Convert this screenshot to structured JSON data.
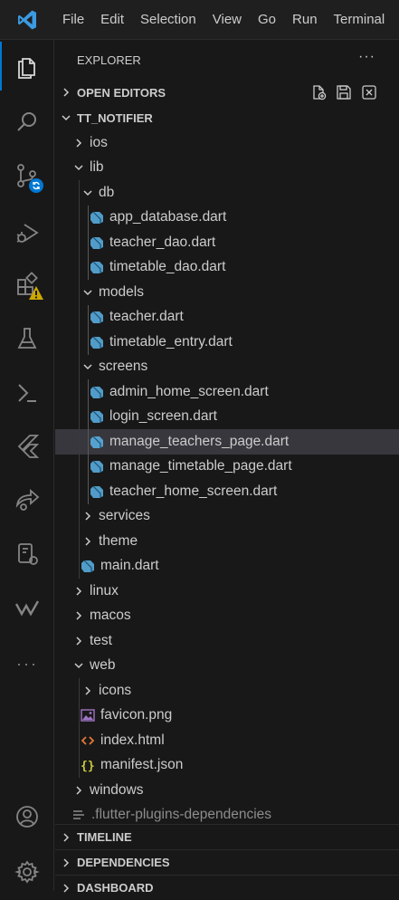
{
  "menu": [
    "File",
    "Edit",
    "Selection",
    "View",
    "Go",
    "Run",
    "Terminal"
  ],
  "activity_icons": [
    "explorer-icon",
    "search-icon",
    "source-control-icon",
    "run-debug-icon",
    "extensions-icon",
    "testing-icon",
    "remote-icon",
    "flutter-icon",
    "liveshare-icon",
    "devices-icon",
    "wakatime-icon",
    "more-icon"
  ],
  "explorer": {
    "title": "EXPLORER",
    "more": "···",
    "open_editors": "OPEN EDITORS",
    "project": "TT_NOTIFIER",
    "tree": [
      {
        "name": "ios",
        "type": "folder",
        "depth": 0,
        "open": false
      },
      {
        "name": "lib",
        "type": "folder",
        "depth": 0,
        "open": true
      },
      {
        "name": "db",
        "type": "folder",
        "depth": 1,
        "open": true
      },
      {
        "name": "app_database.dart",
        "type": "dart",
        "depth": 2
      },
      {
        "name": "teacher_dao.dart",
        "type": "dart",
        "depth": 2
      },
      {
        "name": "timetable_dao.dart",
        "type": "dart",
        "depth": 2
      },
      {
        "name": "models",
        "type": "folder",
        "depth": 1,
        "open": true
      },
      {
        "name": "teacher.dart",
        "type": "dart",
        "depth": 2
      },
      {
        "name": "timetable_entry.dart",
        "type": "dart",
        "depth": 2
      },
      {
        "name": "screens",
        "type": "folder",
        "depth": 1,
        "open": true
      },
      {
        "name": "admin_home_screen.dart",
        "type": "dart",
        "depth": 2
      },
      {
        "name": "login_screen.dart",
        "type": "dart",
        "depth": 2
      },
      {
        "name": "manage_teachers_page.dart",
        "type": "dart",
        "depth": 2,
        "selected": true
      },
      {
        "name": "manage_timetable_page.dart",
        "type": "dart",
        "depth": 2
      },
      {
        "name": "teacher_home_screen.dart",
        "type": "dart",
        "depth": 2
      },
      {
        "name": "services",
        "type": "folder",
        "depth": 1,
        "open": false
      },
      {
        "name": "theme",
        "type": "folder",
        "depth": 1,
        "open": false
      },
      {
        "name": "main.dart",
        "type": "dart",
        "depth": 1
      },
      {
        "name": "linux",
        "type": "folder",
        "depth": 0,
        "open": false
      },
      {
        "name": "macos",
        "type": "folder",
        "depth": 0,
        "open": false
      },
      {
        "name": "test",
        "type": "folder",
        "depth": 0,
        "open": false
      },
      {
        "name": "web",
        "type": "folder",
        "depth": 0,
        "open": true
      },
      {
        "name": "icons",
        "type": "folder",
        "depth": 1,
        "open": false
      },
      {
        "name": "favicon.png",
        "type": "image",
        "depth": 1
      },
      {
        "name": "index.html",
        "type": "html",
        "depth": 1
      },
      {
        "name": "manifest.json",
        "type": "json",
        "depth": 1
      },
      {
        "name": "windows",
        "type": "folder",
        "depth": 0,
        "open": false
      },
      {
        "name": ".flutter-plugins-dependencies",
        "type": "config",
        "depth": 0
      }
    ],
    "bottom_sections": [
      "TIMELINE",
      "DEPENDENCIES",
      "DASHBOARD"
    ]
  },
  "colors": {
    "accent": "#0078d4",
    "dart": "#5cb4e8",
    "warning": "#cca700",
    "json": "#cbcb41",
    "html": "#e37933",
    "image": "#a074c4"
  }
}
